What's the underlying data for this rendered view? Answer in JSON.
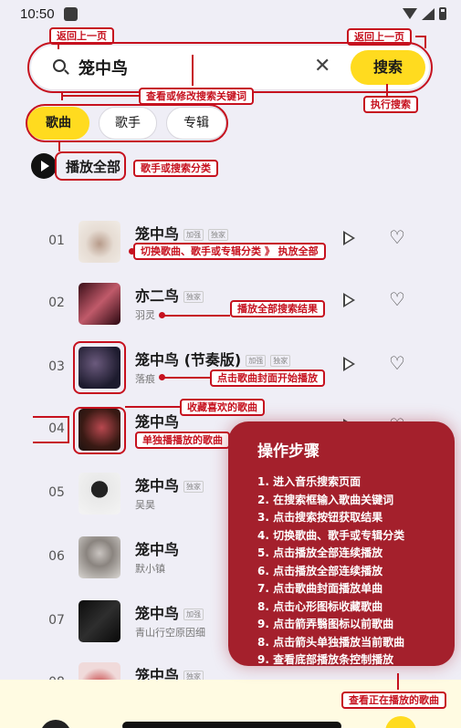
{
  "status": {
    "time": "10:50"
  },
  "search": {
    "query": "笼中鸟",
    "button_label": "搜索"
  },
  "tabs": [
    {
      "label": "歌曲",
      "active": true
    },
    {
      "label": "歌手",
      "active": false
    },
    {
      "label": "专辑",
      "active": false
    }
  ],
  "play_all": {
    "label": "播放全部"
  },
  "songs": [
    {
      "index": "01",
      "title": "笼中鸟",
      "tags": [
        "加强",
        "独家"
      ],
      "artist": ""
    },
    {
      "index": "02",
      "title": "亦二鸟",
      "tags": [
        "独家"
      ],
      "artist": "羽灵"
    },
    {
      "index": "03",
      "title": "笼中鸟 (节奏版)",
      "tags": [
        "加强",
        "独家"
      ],
      "artist": "落痕"
    },
    {
      "index": "04",
      "title": "笼中鸟",
      "tags": [],
      "artist": ""
    },
    {
      "index": "05",
      "title": "笼中鸟",
      "tags": [
        "独家"
      ],
      "artist": "吴昊"
    },
    {
      "index": "06",
      "title": "笼中鸟",
      "tags": [],
      "artist": "默小镇"
    },
    {
      "index": "07",
      "title": "笼中鸟",
      "tags": [
        "加强"
      ],
      "artist": "青山行空原因细"
    },
    {
      "index": "08",
      "title": "笼中鸟",
      "tags": [
        "独家"
      ],
      "artist": ""
    }
  ],
  "annotations": {
    "back_left": "返回上一页",
    "back_right": "返回上一页",
    "edit_keyword": "查看或修改搜索关键词",
    "execute_search": "执行搜索",
    "category": "歌手或搜索分类",
    "switch": "切换歌曲、歌手或专辑分类 》 执放全部",
    "play_all_results": "播放全部搜索结果",
    "cover_play": "点击歌曲封面开始播放",
    "favorite": "收藏喜欢的歌曲",
    "single_play": "单独播播放的歌曲",
    "now_playing": "查看正在播放的歌曲"
  },
  "steps": {
    "title": "操作步骤",
    "items": [
      "1. 进入音乐搜索页面",
      "2. 在搜索框输入歌曲关键词",
      "3. 点击搜索按钮获取结果",
      "4. 切换歌曲、歌手或专辑分类",
      "5. 点击播放全部连续播放",
      "6. 点击播放全部连续播放",
      "7. 点击歌曲封面播放单曲",
      "8. 点击心形图标收藏歌曲",
      "9. 点击箭弄翳图标以前歌曲",
      "8. 点击箭头单独播放当前歌曲",
      "9. 查看底部播放条控制播放"
    ]
  },
  "colors": {
    "accent": "#ffdb1f",
    "annotation": "#c6111e",
    "steps_bg": "#a4202c"
  }
}
